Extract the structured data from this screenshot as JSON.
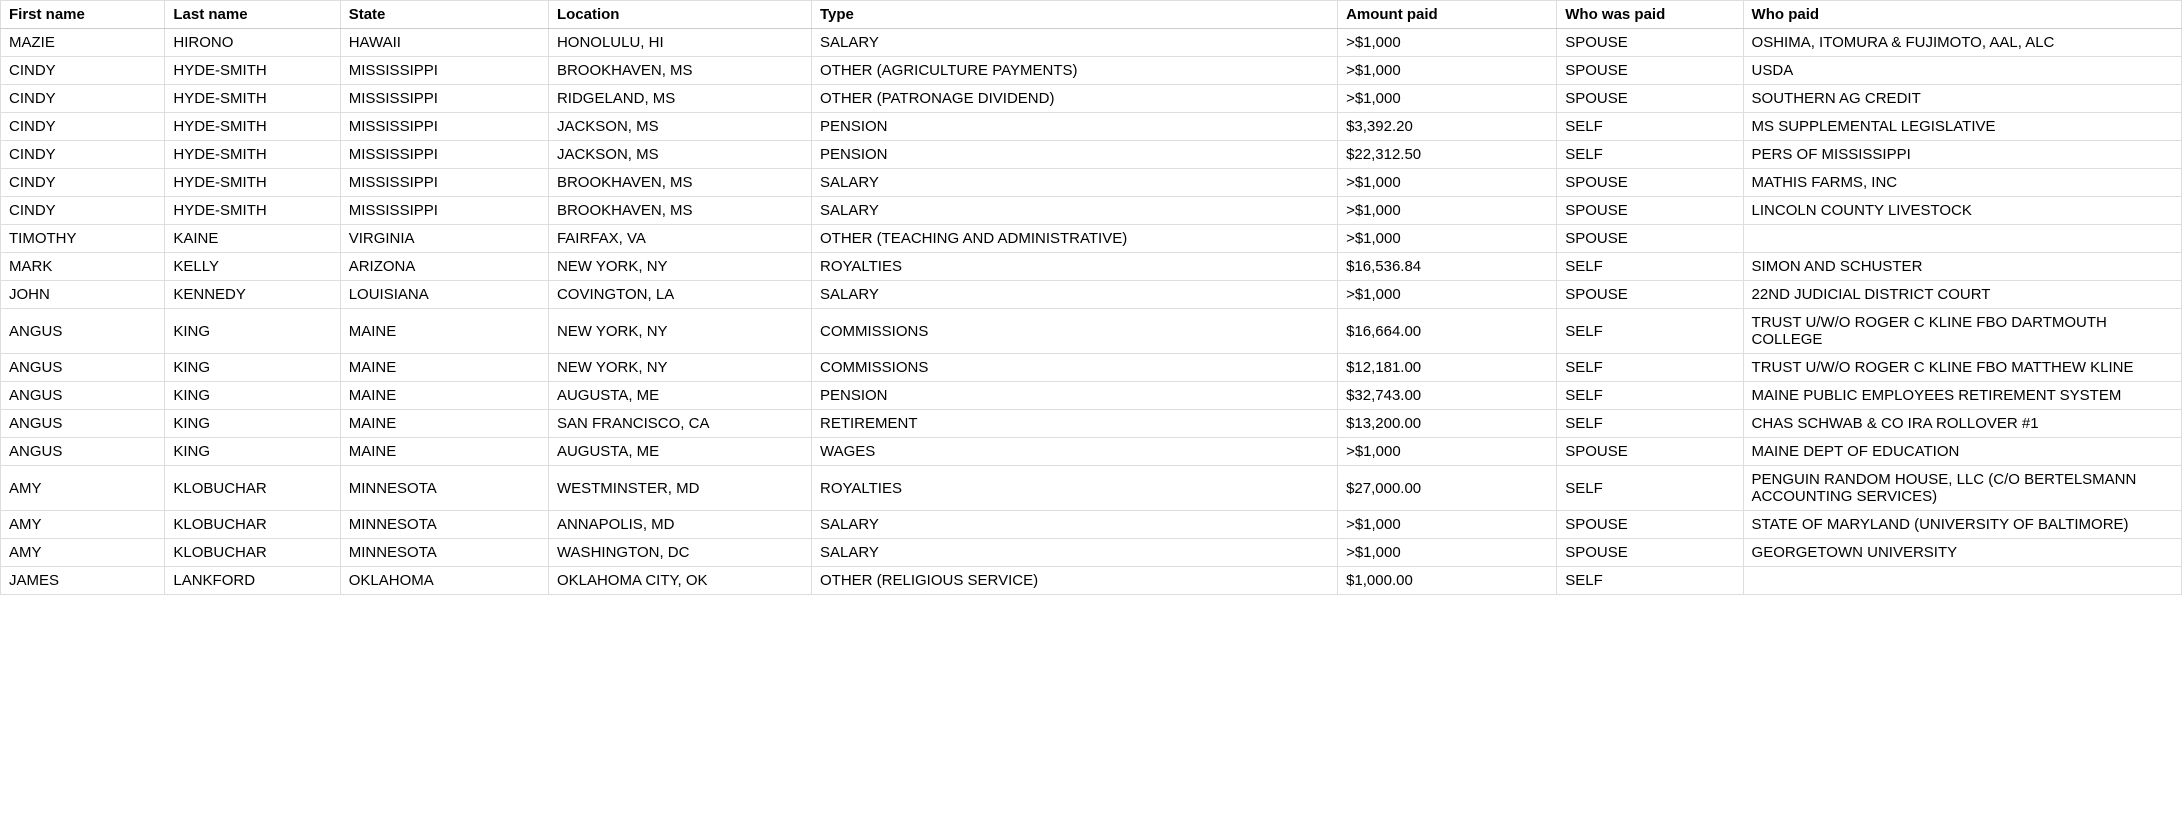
{
  "columns": [
    {
      "key": "first_name",
      "label": "First name"
    },
    {
      "key": "last_name",
      "label": "Last name"
    },
    {
      "key": "state",
      "label": "State"
    },
    {
      "key": "location",
      "label": "Location"
    },
    {
      "key": "type",
      "label": "Type"
    },
    {
      "key": "amount_paid",
      "label": "Amount paid"
    },
    {
      "key": "who_was_paid",
      "label": "Who was paid"
    },
    {
      "key": "who_paid",
      "label": "Who paid"
    }
  ],
  "rows": [
    {
      "first_name": "MAZIE",
      "last_name": "HIRONO",
      "state": "HAWAII",
      "location": "HONOLULU, HI",
      "type": "SALARY",
      "amount_paid": ">$1,000",
      "who_was_paid": "SPOUSE",
      "who_paid": "OSHIMA, ITOMURA & FUJIMOTO, AAL, ALC"
    },
    {
      "first_name": "CINDY",
      "last_name": "HYDE-SMITH",
      "state": "MISSISSIPPI",
      "location": "BROOKHAVEN, MS",
      "type": "OTHER (AGRICULTURE PAYMENTS)",
      "amount_paid": ">$1,000",
      "who_was_paid": "SPOUSE",
      "who_paid": "USDA"
    },
    {
      "first_name": "CINDY",
      "last_name": "HYDE-SMITH",
      "state": "MISSISSIPPI",
      "location": "RIDGELAND, MS",
      "type": "OTHER (PATRONAGE DIVIDEND)",
      "amount_paid": ">$1,000",
      "who_was_paid": "SPOUSE",
      "who_paid": "SOUTHERN AG CREDIT"
    },
    {
      "first_name": "CINDY",
      "last_name": "HYDE-SMITH",
      "state": "MISSISSIPPI",
      "location": "JACKSON, MS",
      "type": "PENSION",
      "amount_paid": "$3,392.20",
      "who_was_paid": "SELF",
      "who_paid": "MS SUPPLEMENTAL LEGISLATIVE"
    },
    {
      "first_name": "CINDY",
      "last_name": "HYDE-SMITH",
      "state": "MISSISSIPPI",
      "location": "JACKSON, MS",
      "type": "PENSION",
      "amount_paid": "$22,312.50",
      "who_was_paid": "SELF",
      "who_paid": "PERS OF MISSISSIPPI"
    },
    {
      "first_name": "CINDY",
      "last_name": "HYDE-SMITH",
      "state": "MISSISSIPPI",
      "location": "BROOKHAVEN, MS",
      "type": "SALARY",
      "amount_paid": ">$1,000",
      "who_was_paid": "SPOUSE",
      "who_paid": "MATHIS FARMS, INC"
    },
    {
      "first_name": "CINDY",
      "last_name": "HYDE-SMITH",
      "state": "MISSISSIPPI",
      "location": "BROOKHAVEN, MS",
      "type": "SALARY",
      "amount_paid": ">$1,000",
      "who_was_paid": "SPOUSE",
      "who_paid": "LINCOLN COUNTY LIVESTOCK"
    },
    {
      "first_name": "TIMOTHY",
      "last_name": "KAINE",
      "state": "VIRGINIA",
      "location": "FAIRFAX, VA",
      "type": "OTHER (TEACHING AND ADMINISTRATIVE)",
      "amount_paid": ">$1,000",
      "who_was_paid": "SPOUSE",
      "who_paid": ""
    },
    {
      "first_name": "MARK",
      "last_name": "KELLY",
      "state": "ARIZONA",
      "location": "NEW YORK, NY",
      "type": "ROYALTIES",
      "amount_paid": "$16,536.84",
      "who_was_paid": "SELF",
      "who_paid": "SIMON AND SCHUSTER"
    },
    {
      "first_name": "JOHN",
      "last_name": "KENNEDY",
      "state": "LOUISIANA",
      "location": "COVINGTON, LA",
      "type": "SALARY",
      "amount_paid": ">$1,000",
      "who_was_paid": "SPOUSE",
      "who_paid": "22ND JUDICIAL DISTRICT COURT"
    },
    {
      "first_name": "ANGUS",
      "last_name": "KING",
      "state": "MAINE",
      "location": "NEW YORK, NY",
      "type": "COMMISSIONS",
      "amount_paid": "$16,664.00",
      "who_was_paid": "SELF",
      "who_paid": "TRUST U/W/O ROGER C KLINE FBO DARTMOUTH COLLEGE"
    },
    {
      "first_name": "ANGUS",
      "last_name": "KING",
      "state": "MAINE",
      "location": "NEW YORK, NY",
      "type": "COMMISSIONS",
      "amount_paid": "$12,181.00",
      "who_was_paid": "SELF",
      "who_paid": "TRUST U/W/O ROGER C KLINE FBO MATTHEW KLINE"
    },
    {
      "first_name": "ANGUS",
      "last_name": "KING",
      "state": "MAINE",
      "location": "AUGUSTA, ME",
      "type": "PENSION",
      "amount_paid": "$32,743.00",
      "who_was_paid": "SELF",
      "who_paid": "MAINE PUBLIC EMPLOYEES RETIREMENT SYSTEM"
    },
    {
      "first_name": "ANGUS",
      "last_name": "KING",
      "state": "MAINE",
      "location": "SAN FRANCISCO, CA",
      "type": "RETIREMENT",
      "amount_paid": "$13,200.00",
      "who_was_paid": "SELF",
      "who_paid": "CHAS SCHWAB & CO IRA ROLLOVER #1"
    },
    {
      "first_name": "ANGUS",
      "last_name": "KING",
      "state": "MAINE",
      "location": "AUGUSTA, ME",
      "type": "WAGES",
      "amount_paid": ">$1,000",
      "who_was_paid": "SPOUSE",
      "who_paid": "MAINE DEPT OF EDUCATION"
    },
    {
      "first_name": "AMY",
      "last_name": "KLOBUCHAR",
      "state": "MINNESOTA",
      "location": "WESTMINSTER, MD",
      "type": "ROYALTIES",
      "amount_paid": "$27,000.00",
      "who_was_paid": "SELF",
      "who_paid": "PENGUIN RANDOM HOUSE, LLC (C/O BERTELSMANN ACCOUNTING SERVICES)"
    },
    {
      "first_name": "AMY",
      "last_name": "KLOBUCHAR",
      "state": "MINNESOTA",
      "location": "ANNAPOLIS, MD",
      "type": "SALARY",
      "amount_paid": ">$1,000",
      "who_was_paid": "SPOUSE",
      "who_paid": "STATE OF MARYLAND (UNIVERSITY OF BALTIMORE)"
    },
    {
      "first_name": "AMY",
      "last_name": "KLOBUCHAR",
      "state": "MINNESOTA",
      "location": "WASHINGTON, DC",
      "type": "SALARY",
      "amount_paid": ">$1,000",
      "who_was_paid": "SPOUSE",
      "who_paid": "GEORGETOWN UNIVERSITY"
    },
    {
      "first_name": "JAMES",
      "last_name": "LANKFORD",
      "state": "OKLAHOMA",
      "location": "OKLAHOMA CITY, OK",
      "type": "OTHER (RELIGIOUS SERVICE)",
      "amount_paid": "$1,000.00",
      "who_was_paid": "SELF",
      "who_paid": ""
    }
  ]
}
